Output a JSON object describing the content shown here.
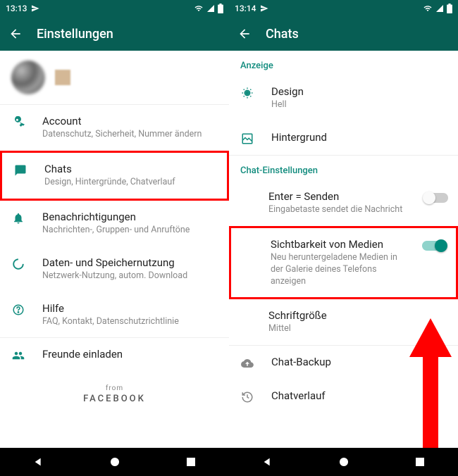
{
  "left": {
    "status_time": "13:13",
    "appbar_title": "Einstellungen",
    "items": {
      "account": {
        "title": "Account",
        "sub": "Datenschutz, Sicherheit, Nummer ändern"
      },
      "chats": {
        "title": "Chats",
        "sub": "Design, Hintergründe, Chatverlauf"
      },
      "notif": {
        "title": "Benachrichtigungen",
        "sub": "Nachrichten-, Gruppen- und Anruftöne"
      },
      "data": {
        "title": "Daten- und Speichernutzung",
        "sub": "Netzwerk-Nutzung, autom. Download"
      },
      "help": {
        "title": "Hilfe",
        "sub": "FAQ, Kontakt, Datenschutzrichtlinie"
      },
      "invite": {
        "title": "Freunde einladen"
      }
    },
    "footer_from": "from",
    "footer_brand": "FACEBOOK"
  },
  "right": {
    "status_time": "13:14",
    "appbar_title": "Chats",
    "section_display": "Anzeige",
    "design": {
      "title": "Design",
      "sub": "Hell"
    },
    "wallpaper": {
      "title": "Hintergrund"
    },
    "section_chat": "Chat-Einstellungen",
    "enter": {
      "title": "Enter = Senden",
      "sub": "Eingabetaste sendet die Nachricht"
    },
    "media": {
      "title": "Sichtbarkeit von Medien",
      "sub": "Neu heruntergeladene Medien in der Galerie deines Telefons anzeigen"
    },
    "font": {
      "title": "Schriftgröße",
      "sub": "Mittel"
    },
    "backup": {
      "title": "Chat-Backup"
    },
    "history": {
      "title": "Chatverlauf"
    }
  }
}
